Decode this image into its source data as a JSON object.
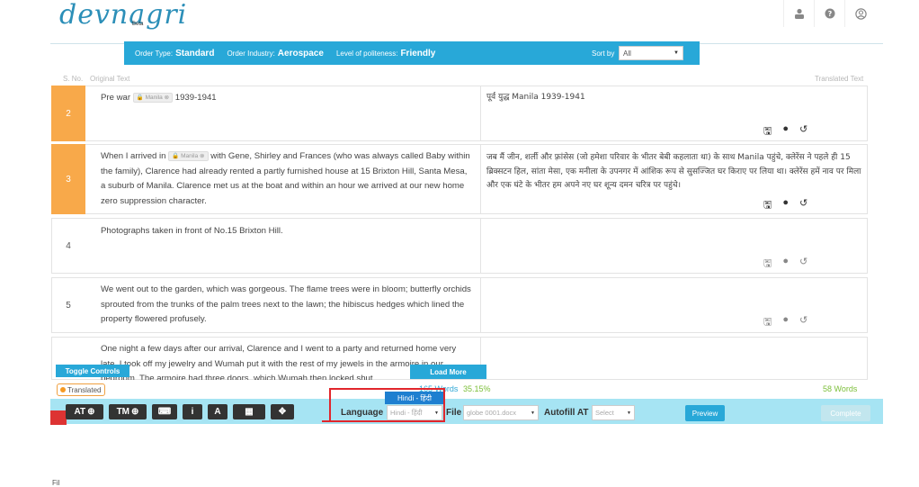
{
  "header": {
    "logo": "devnagri",
    "beta": "Beta",
    "icons": [
      "user-icon",
      "help-icon",
      "account-icon"
    ]
  },
  "order_bar": {
    "type_label": "Order Type:",
    "type_value": "Standard",
    "industry_label": "Order Industry:",
    "industry_value": "Aerospace",
    "politeness_label": "Level of politeness:",
    "politeness_value": "Friendly",
    "sort_label": "Sort by",
    "sort_value": "All"
  },
  "columns": {
    "sno": "S. No.",
    "original": "Original Text",
    "translated": "Translated Text"
  },
  "rows": [
    {
      "num": "2",
      "src_pre": "Pre war",
      "src_tag": "Manila",
      "src_post": "1939-1941",
      "dst": "पूर्व युद्ध Manila 1939-1941"
    },
    {
      "num": "3",
      "src_pre": "When I arrived in",
      "src_tag": "Manila",
      "src_post": "with Gene, Shirley and Frances (who was always called Baby within the family), Clarence had already rented a partly furnished house at 15 Brixton Hill, Santa Mesa, a suburb of Manila. Clarence met us at the boat and within an hour we arrived at our new home zero suppression character.",
      "dst": "जब मैं जीन, शर्ली और फ़्रांसेस (जो हमेशा परिवार के भीतर बेबी कहलाता था) के साथ Manila पहुंचे, क्लेरेंस ने पहले ही 15 ब्रिक्सटन हिल, सांता मेसा, एक मनीला के उपनगर में आंशिक रूप से सुसज्जित घर किराए पर लिया था। क्लेरेंस हमें नाव पर मिला और एक घंटे के भीतर हम अपने नए घर शून्य दमन चरित्र पर पहुंचे।"
    },
    {
      "num": "4",
      "src": "Photographs taken in front of No.15 Brixton Hill."
    },
    {
      "num": "5",
      "src": "We went out to the garden, which was gorgeous. The flame trees were in bloom; butterfly orchids sprouted from the trunks of the palm trees next to the lawn; the hibiscus hedges which lined the property flowered profusely."
    },
    {
      "num": "",
      "src": "One night a few days after our arrival, Clarence and I went to a party and returned home very late. I took off my jewelry and Wumah put it with the rest of my jewels in the armoire in our bedroom. The armoire had three doors, which Wumah then locked shut."
    }
  ],
  "controls": {
    "toggle": "Toggle Controls",
    "load_more": "Load More",
    "translated_badge": "Translated",
    "words_total": "165 Words",
    "percent": "35.15%",
    "words_done": "58 Words"
  },
  "toolbar": {
    "at": "AT",
    "tm": "TM",
    "info": "i",
    "font": "A",
    "language_label": "Language",
    "language_value": "Hindi - हिंदी",
    "language_option": "Hindi - हिंदी",
    "file_label": "File",
    "file_value": "globe 0001.docx",
    "autofill_label": "Autofill AT",
    "autofill_value": "Select",
    "preview": "Preview",
    "complete": "Complete"
  },
  "footer_text": "Fil"
}
